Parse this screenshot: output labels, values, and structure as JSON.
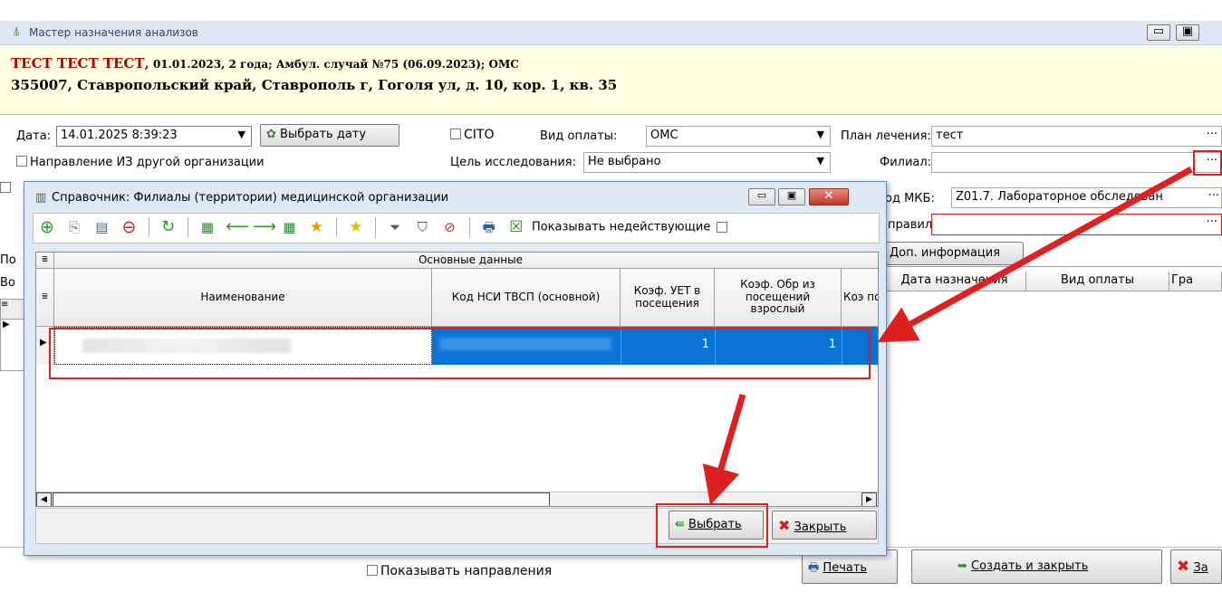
{
  "top_link_cut": "",
  "main_window": {
    "title": "Мастер назначения анализов",
    "patient_line1_bold": "ТЕСТ ТЕСТ ТЕСТ,",
    "patient_line1_rest": " 01.01.2023, 2 года; Амбул. случай №75 (06.09.2023); ОМС",
    "patient_line2": "355007, Ставропольский край, Ставрополь г, Гоголя ул, д. 10, кор. 1, кв. 35",
    "date_label": "Дата:",
    "date_value": "14.01.2025 8:39:23",
    "pick_date_button": "Выбрать дату",
    "cito_label": "CITO",
    "payment_label": "Вид оплаты:",
    "payment_value": "ОМС",
    "plan_label": "План лечения:",
    "plan_value": "тест",
    "external_org_label": "Направление ИЗ другой организации",
    "goal_label": "Цель исследования:",
    "goal_value": "Не выбрано",
    "branch_label": "Филиал:",
    "branch_value": "",
    "mkb_label": "од МКБ:",
    "mkb_value": "Z01.7. Лабораторное обследован",
    "sent_label": "правил:",
    "sent_value": "",
    "extra_info_tab": "Доп. информация",
    "grid_headers": [
      "Дата назначения",
      "Вид оплаты",
      "Гра"
    ],
    "left_cut_labels": [
      "По",
      "Во"
    ],
    "show_referrals_label": "Показывать направления",
    "print_button": "Печать",
    "create_close_button": "Создать и закрыть",
    "close_button_cut": "За"
  },
  "dialog": {
    "title": "Справочник: Филиалы (территории) медицинской организации",
    "show_inactive_label": "Показывать недействующие",
    "group_header": "Основные данные",
    "columns": [
      "Наименование",
      "Код НСИ ТВСП (основной)",
      "Коэф. УЕТ в посещения",
      "Коэф. Обр из посещений взрослый",
      "Коэ по д"
    ],
    "row": {
      "name": "",
      "code": "",
      "k1": "1",
      "k2": "1"
    },
    "select_button": "Выбрать",
    "close_button": "Закрыть"
  },
  "colors": {
    "accent_red": "#e02020",
    "selection_blue": "#0a74d6",
    "info_bg": "#ffffe1"
  }
}
